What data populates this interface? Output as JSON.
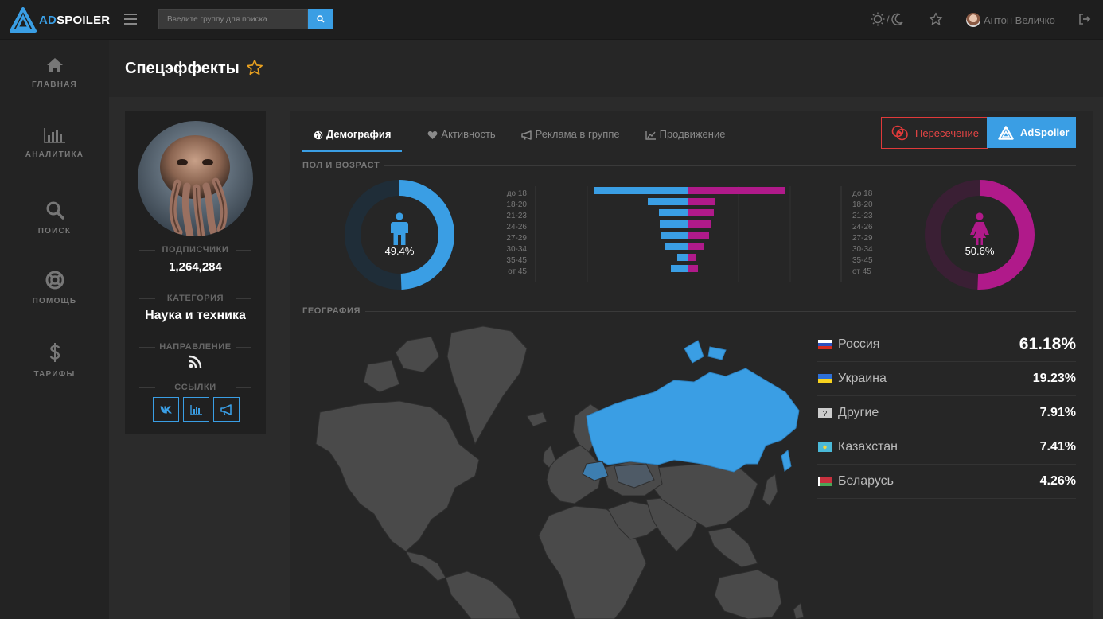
{
  "app": {
    "logo_ad": "AD",
    "logo_spoiler": "SPOILER",
    "search_placeholder": "Введите группу для поиска",
    "theme_sep": "/",
    "user_name": "Антон Величко"
  },
  "sidebar": {
    "items": [
      {
        "label": "ГЛАВНАЯ",
        "icon": "home-icon"
      },
      {
        "label": "АНАЛИТИКА",
        "icon": "chart-icon"
      },
      {
        "label": "ПОИСК",
        "icon": "search-icon"
      },
      {
        "label": "ПОМОЩЬ",
        "icon": "lifebuoy-icon"
      },
      {
        "label": "ТАРИФЫ",
        "icon": "dollar-icon"
      }
    ]
  },
  "page": {
    "title": "Спецэффекты"
  },
  "profile": {
    "subscribers_label": "ПОДПИСЧИКИ",
    "subscribers_value": "1,264,284",
    "category_label": "КАТЕГОРИЯ",
    "category_value": "Наука и техника",
    "direction_label": "НАПРАВЛЕНИЕ",
    "links_label": "ССЫЛКИ"
  },
  "tabs": [
    {
      "label": "Демография",
      "active": true,
      "icon": "globe-icon"
    },
    {
      "label": "Активность",
      "active": false,
      "icon": "heart-icon"
    },
    {
      "label": "Реклама в группе",
      "active": false,
      "icon": "bullhorn-icon"
    },
    {
      "label": "Продвижение",
      "active": false,
      "icon": "line-chart-icon"
    }
  ],
  "buttons": {
    "intersection": "Пересечение",
    "adspoiler": "AdSpoiler"
  },
  "demography": {
    "section_title": "ПОЛ И ВОЗРАСТ",
    "male_pct_label": "49.4%",
    "female_pct_label": "50.6%",
    "male_fraction": 0.494,
    "female_fraction": 0.506,
    "age_groups": [
      "до 18",
      "18-20",
      "21-23",
      "24-26",
      "27-29",
      "30-34",
      "35-45",
      "от 45"
    ],
    "male_values": [
      119,
      51,
      37,
      36,
      35,
      30,
      14,
      22
    ],
    "female_values": [
      122,
      33,
      32,
      28,
      26,
      19,
      9,
      12
    ],
    "male_color": "#3a9ee4",
    "female_color": "#b01a8a"
  },
  "geography": {
    "section_title": "ГЕОГРАФИЯ",
    "countries": [
      {
        "name": "Россия",
        "pct": "61.18%"
      },
      {
        "name": "Украина",
        "pct": "19.23%"
      },
      {
        "name": "Другие",
        "pct": "7.91%"
      },
      {
        "name": "Казахстан",
        "pct": "7.41%"
      },
      {
        "name": "Беларусь",
        "pct": "4.26%"
      }
    ]
  }
}
